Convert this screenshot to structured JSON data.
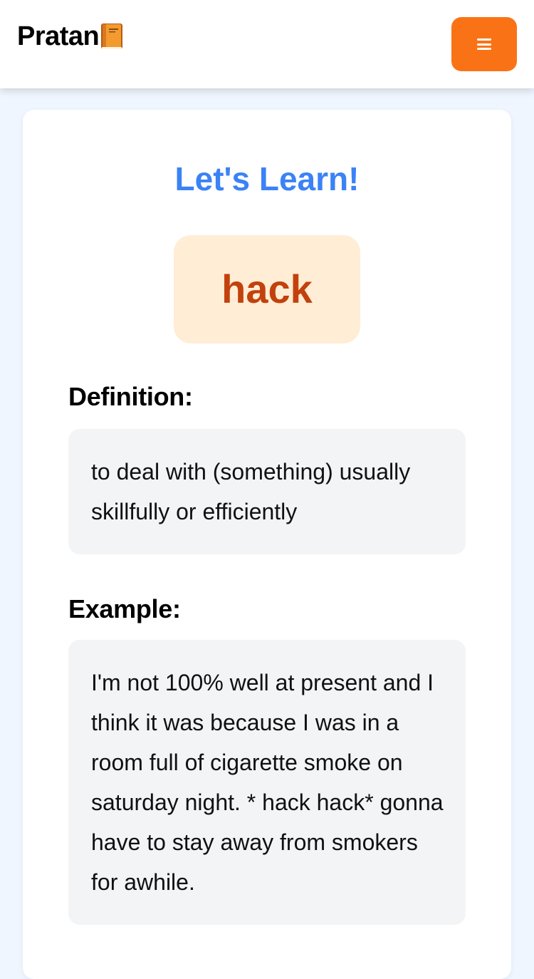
{
  "app": {
    "brand_name": "Pratan",
    "brand_icon": "ledger-book-icon"
  },
  "header": {
    "menu_icon": "hamburger-menu-icon",
    "menu_button_color": "#f97316"
  },
  "main": {
    "title": "Let's Learn!",
    "word": "hack",
    "definition_label": "Definition:",
    "definition_text": "to deal with (something) usually skillfully or efficiently",
    "example_label": "Example:",
    "example_text": "I'm not 100% well at present and I think it was because I was in a room full of cigarette smoke on saturday night. * hack hack* gonna have to stay away from smokers for awhile."
  },
  "colors": {
    "title": "#3b82f6",
    "word_text": "#c2410c",
    "word_background": "#ffedd5",
    "page_background": "#eff6ff",
    "text_box_background": "#f3f4f6"
  }
}
